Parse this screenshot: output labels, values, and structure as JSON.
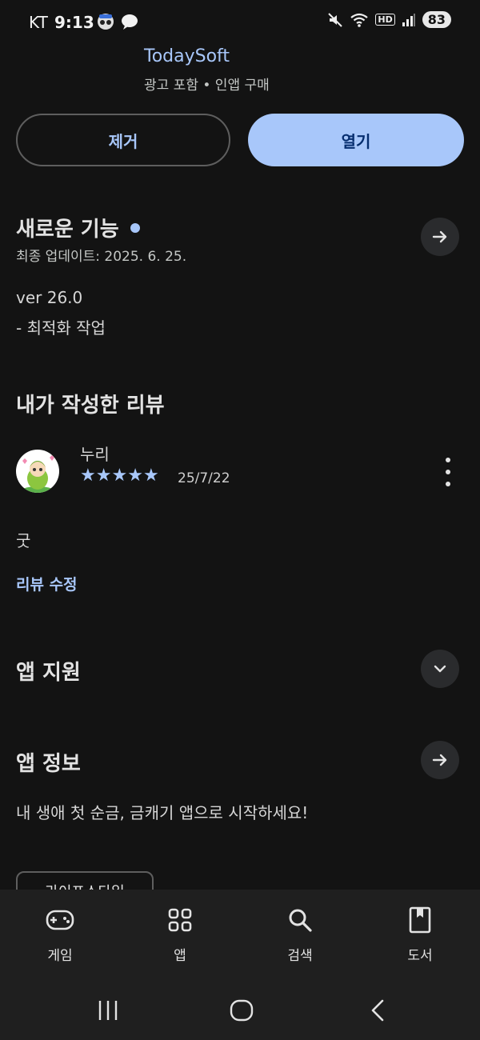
{
  "status_bar": {
    "carrier": "KT",
    "time": "9:13",
    "battery": "83",
    "hd_label": "HD"
  },
  "app": {
    "developer": "TodaySoft",
    "meta": "광고 포함  •  인앱 구매"
  },
  "actions": {
    "uninstall_label": "제거",
    "open_label": "열기"
  },
  "whats_new": {
    "title": "새로운 기능",
    "updated": "최종 업데이트: 2025. 6. 25.",
    "version": "ver 26.0",
    "notes": "- 최적화 작업"
  },
  "my_review": {
    "title": "내가 작성한 리뷰",
    "author": "누리",
    "rating": 5,
    "date": "25/7/22",
    "text": "굿",
    "edit_label": "리뷰 수정"
  },
  "app_support": {
    "title": "앱 지원"
  },
  "app_info": {
    "title": "앱 정보",
    "description": "내 생애 첫 순금, 금캐기 앱으로 시작하세요!",
    "chip_label": "라이프스타일"
  },
  "bottom_nav": {
    "games": "게임",
    "apps": "앱",
    "search": "검색",
    "books": "도서"
  },
  "colors": {
    "accent": "#a8c7fa",
    "background": "#131313"
  }
}
